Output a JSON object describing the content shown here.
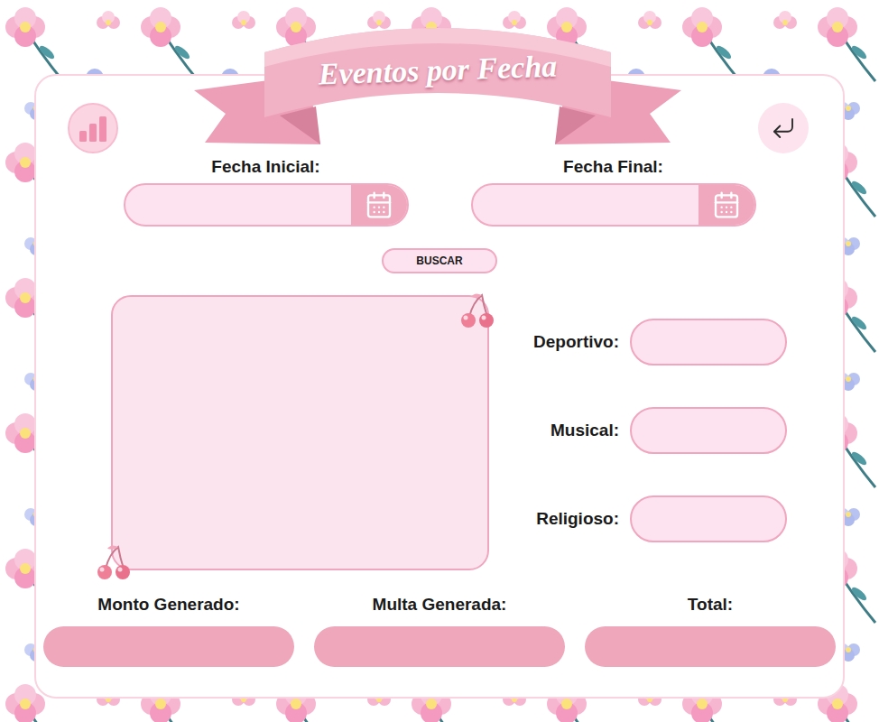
{
  "window": {
    "title": "Eventos por Fecha"
  },
  "date_fields": [
    {
      "label": "Fecha Inicial:",
      "value": ""
    },
    {
      "label": "Fecha Final:",
      "value": ""
    }
  ],
  "search_button": {
    "label": "BUSCAR"
  },
  "results": {
    "value": ""
  },
  "categories": [
    {
      "label": "Deportivo:",
      "value": ""
    },
    {
      "label": "Musical:",
      "value": ""
    },
    {
      "label": "Religioso:",
      "value": ""
    }
  ],
  "totals": [
    {
      "label": "Monto Generado:",
      "value": ""
    },
    {
      "label": "Multa Generada:",
      "value": ""
    },
    {
      "label": "Total:",
      "value": ""
    }
  ]
}
